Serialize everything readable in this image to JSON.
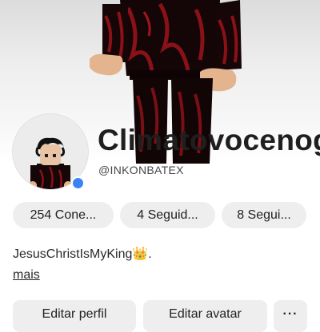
{
  "profile": {
    "display_name": "Climatovocenog",
    "username": "@INKONBATEX",
    "online_status_color": "#3a83f6",
    "avatar_icon": "roblox-avatar-headshot",
    "banner_icon": "roblox-avatar-full-body"
  },
  "stats": {
    "connections": "254 Cone...",
    "followers": "4 Seguid...",
    "following": "8 Segui..."
  },
  "bio": {
    "text": "JesusChristIsMyKing",
    "emoji": "👑",
    "suffix": ".",
    "more_label": "mais"
  },
  "actions": {
    "edit_profile": "Editar perfil",
    "edit_avatar": "Editar avatar",
    "more": "···"
  }
}
